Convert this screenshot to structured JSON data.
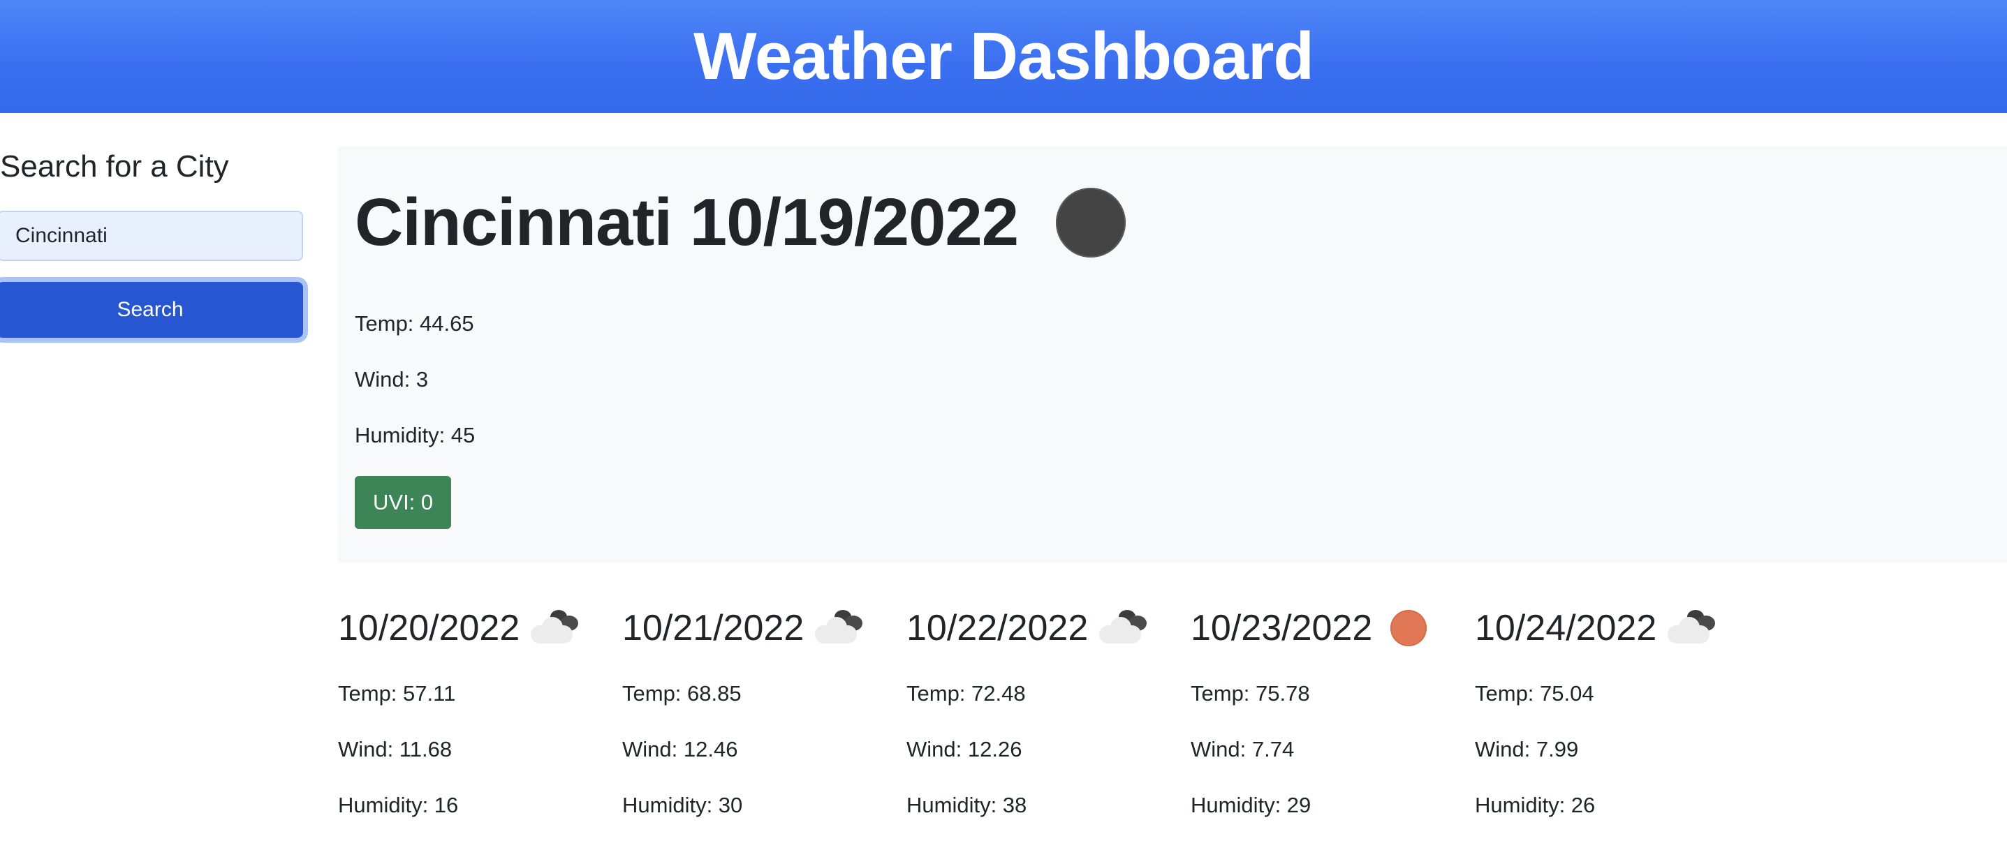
{
  "header": {
    "title": "Weather Dashboard"
  },
  "sidebar": {
    "heading": "Search for a City",
    "search_value": "Cincinnati",
    "search_button_label": "Search"
  },
  "current": {
    "title": "Cincinnati 10/19/2022",
    "icon": "dark-circle-icon",
    "temp": "Temp: 44.65",
    "wind": "Wind: 3",
    "humidity": "Humidity: 45",
    "uvi": "UVI: 0",
    "uvi_color": "#3d8557"
  },
  "forecast": [
    {
      "date": "10/20/2022",
      "icon": "cloud-icon",
      "temp": "Temp: 57.11",
      "wind": "Wind: 11.68",
      "humidity": "Humidity: 16"
    },
    {
      "date": "10/21/2022",
      "icon": "cloud-icon",
      "temp": "Temp: 68.85",
      "wind": "Wind: 12.46",
      "humidity": "Humidity: 30"
    },
    {
      "date": "10/22/2022",
      "icon": "cloud-icon",
      "temp": "Temp: 72.48",
      "wind": "Wind: 12.26",
      "humidity": "Humidity: 38"
    },
    {
      "date": "10/23/2022",
      "icon": "sun-icon",
      "temp": "Temp: 75.78",
      "wind": "Wind: 7.74",
      "humidity": "Humidity: 29"
    },
    {
      "date": "10/24/2022",
      "icon": "cloud-icon",
      "temp": "Temp: 75.04",
      "wind": "Wind: 7.99",
      "humidity": "Humidity: 26"
    }
  ],
  "colors": {
    "header_bg": "#3a6ef0",
    "button_bg": "#2756d3",
    "panel_bg": "#f8f9fa"
  }
}
